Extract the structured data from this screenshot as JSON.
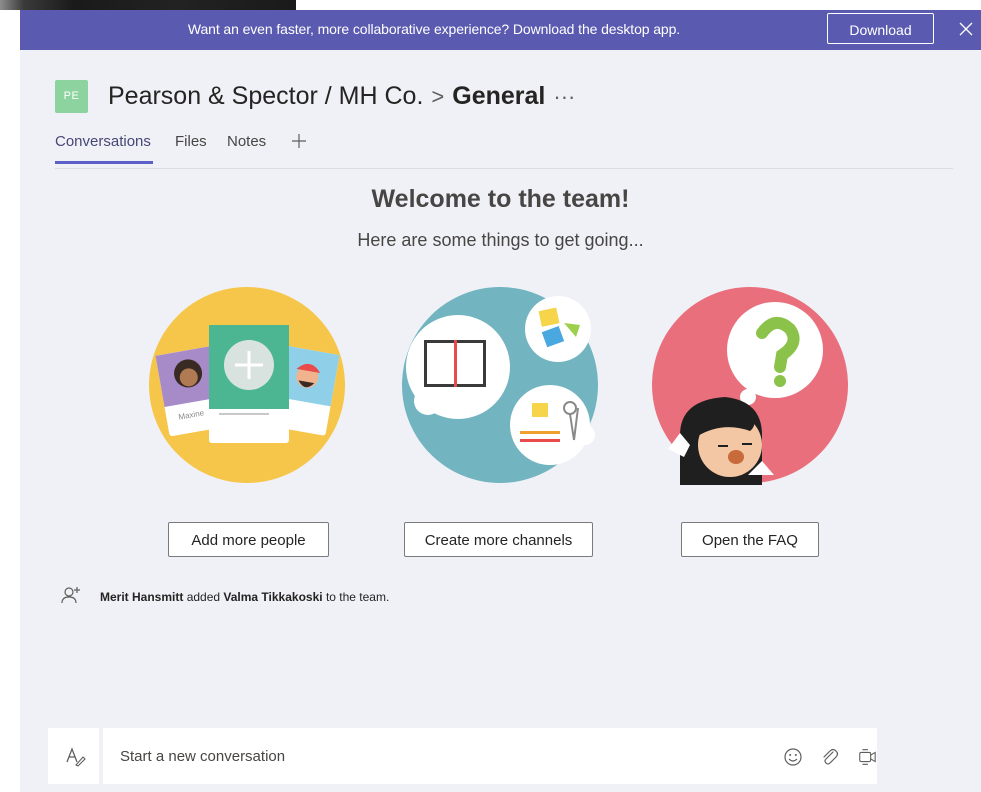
{
  "banner": {
    "text": "Want an even faster, more collaborative experience? Download the desktop app.",
    "download_label": "Download"
  },
  "header": {
    "team_initials": "PE",
    "team_name": "Pearson & Spector / MH Co.",
    "separator": ">",
    "channel_name": "General",
    "more": "···"
  },
  "tabs": [
    {
      "label": "Conversations",
      "active": true
    },
    {
      "label": "Files",
      "active": false
    },
    {
      "label": "Notes",
      "active": false
    }
  ],
  "welcome": {
    "title": "Welcome to the team!",
    "subtitle": "Here are some things to get going..."
  },
  "actions": [
    {
      "label": "Add more people",
      "icon": "people-cards-illustration"
    },
    {
      "label": "Create more channels",
      "icon": "channels-illustration"
    },
    {
      "label": "Open the FAQ",
      "icon": "faq-illustration"
    }
  ],
  "illustration_text": {
    "card_name": "Maxine"
  },
  "activity": {
    "actor": "Merit Hansmitt",
    "verb": "added",
    "target": "Valma Tikkakoski",
    "suffix": "to the team."
  },
  "composer": {
    "placeholder": "Start a new conversation"
  },
  "colors": {
    "banner": "#5a5ab0",
    "accent": "#5b5fc7",
    "avatar": "#8dd3a0",
    "background": "#f0f1f6"
  }
}
